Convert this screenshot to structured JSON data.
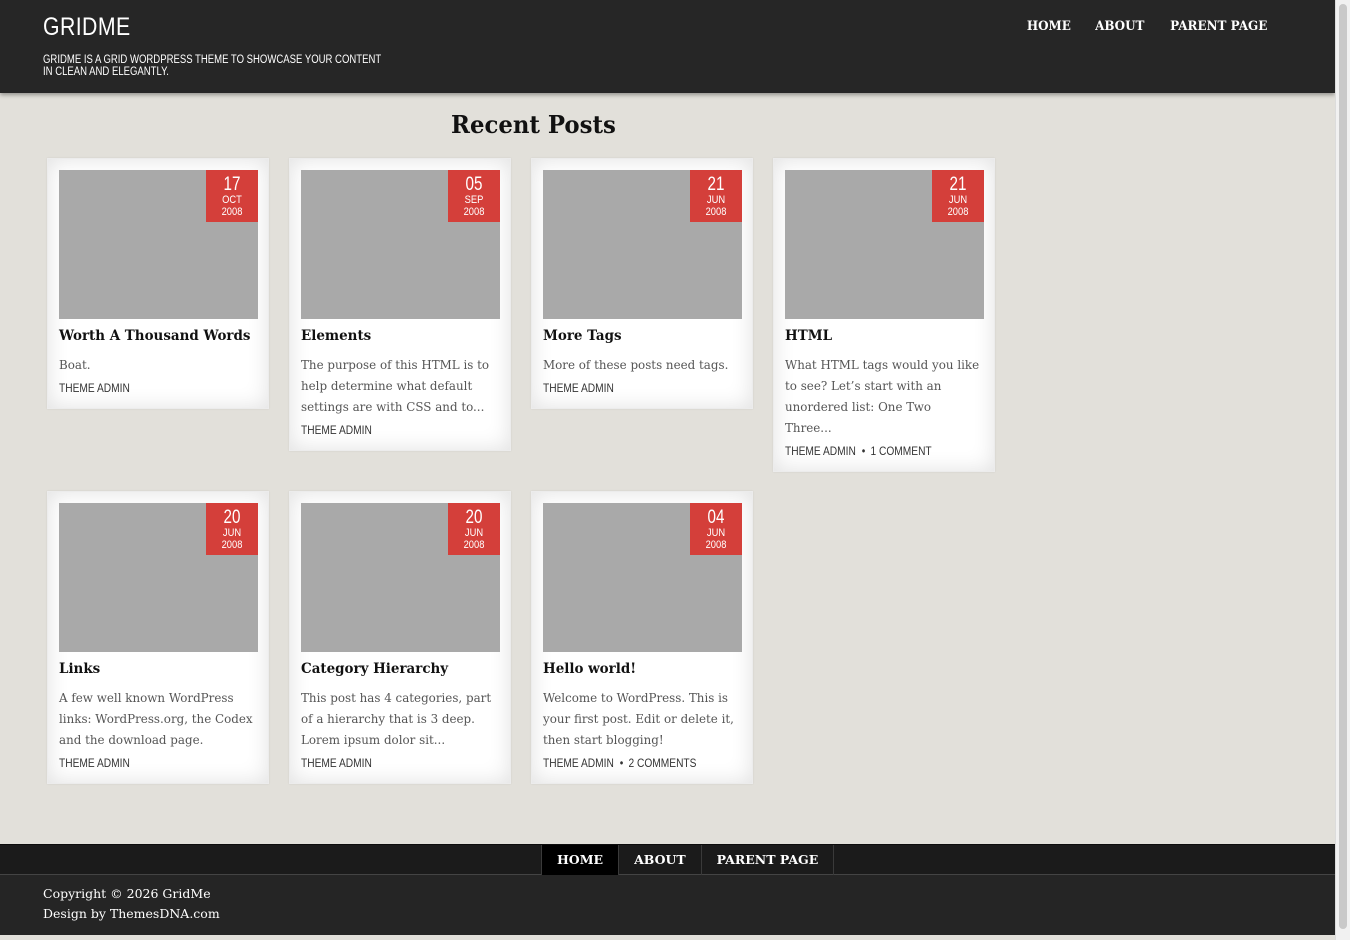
{
  "header": {
    "site_title": "GRIDME",
    "site_description": "GRIDME IS A GRID WORDPRESS THEME TO SHOWCASE YOUR CONTENT IN CLEAN AND ELEGANTLY.",
    "nav": [
      "HOME",
      "ABOUT",
      "PARENT PAGE"
    ]
  },
  "main": {
    "section_title": "Recent Posts",
    "posts": [
      {
        "day": "17",
        "month": "OCT",
        "year": "2008",
        "title": "Worth A Thousand Words",
        "excerpt": "Boat.",
        "author": "THEME ADMIN",
        "comments": ""
      },
      {
        "day": "05",
        "month": "SEP",
        "year": "2008",
        "title": "Elements",
        "excerpt": "The purpose of this HTML is to help determine what default settings are with CSS and to...",
        "author": "THEME ADMIN",
        "comments": ""
      },
      {
        "day": "21",
        "month": "JUN",
        "year": "2008",
        "title": "More Tags",
        "excerpt": "More of these posts need tags.",
        "author": "THEME ADMIN",
        "comments": ""
      },
      {
        "day": "21",
        "month": "JUN",
        "year": "2008",
        "title": "HTML",
        "excerpt": "What HTML tags would you like to see? Let’s start with an unordered list: One Two Three...",
        "author": "THEME ADMIN",
        "comments": "1 COMMENT"
      },
      {
        "day": "20",
        "month": "JUN",
        "year": "2008",
        "title": "Links",
        "excerpt": "A few well known WordPress links: WordPress.org, the Codex and the download page.",
        "author": "THEME ADMIN",
        "comments": ""
      },
      {
        "day": "20",
        "month": "JUN",
        "year": "2008",
        "title": "Category Hierarchy",
        "excerpt": "This post has 4 categories, part of a hierarchy that is 3 deep. Lorem ipsum dolor sit...",
        "author": "THEME ADMIN",
        "comments": ""
      },
      {
        "day": "04",
        "month": "JUN",
        "year": "2008",
        "title": "Hello world!",
        "excerpt": "Welcome to WordPress. This is your first post. Edit or delete it, then start blogging!",
        "author": "THEME ADMIN",
        "comments": "2 COMMENTS"
      }
    ]
  },
  "footer": {
    "nav": [
      "HOME",
      "ABOUT",
      "PARENT PAGE"
    ],
    "copyright": "Copyright © 2026 GridMe",
    "credit": "Design by ThemesDNA.com"
  },
  "colors": {
    "header_bg": "#262626",
    "accent": "#d43f3a",
    "page_bg": "#e2e0da",
    "thumb_placeholder": "#a9a9a9"
  }
}
